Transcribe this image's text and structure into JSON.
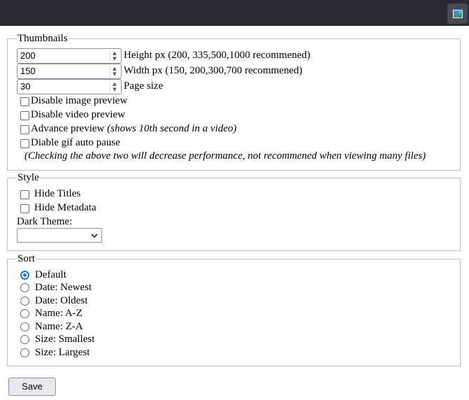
{
  "toolbar": {
    "extension_icon": "image-gallery-icon"
  },
  "thumbnails": {
    "legend": "Thumbnails",
    "height": {
      "value": "200",
      "label": "Height px (200, 335,500,1000 recommened)"
    },
    "width": {
      "value": "150",
      "label": "Width px (150, 200,300,700 recommened)"
    },
    "page_size": {
      "value": "30",
      "label": "Page size"
    },
    "checkboxes": [
      {
        "label": "Disable image preview",
        "checked": false
      },
      {
        "label": "Disable video preview",
        "checked": false
      },
      {
        "label": "Advance preview",
        "note": "(shows 10th second in a video)",
        "checked": false
      },
      {
        "label": "Diable gif auto pause",
        "checked": false
      }
    ],
    "warning": "(Checking the above two will decrease performance, not recommened when viewing many files)"
  },
  "style": {
    "legend": "Style",
    "hide_titles": "Hide Titles",
    "hide_metadata": "Hide Metadata",
    "dark_theme_label": "Dark Theme:",
    "dark_theme_value": ""
  },
  "sort": {
    "legend": "Sort",
    "selected": "Default",
    "options": [
      "Default",
      "Date: Newest",
      "Date: Oldest",
      "Name: A-Z",
      "Name: Z-A",
      "Size: Smallest",
      "Size: Largest"
    ]
  },
  "save_label": "Save",
  "colors": {
    "topbar": "#2b2a33",
    "radio_accent": "#1a73e8"
  }
}
